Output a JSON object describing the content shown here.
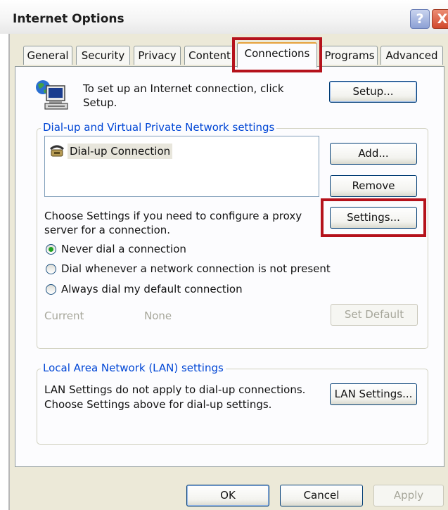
{
  "window": {
    "title": "Internet Options",
    "help_glyph": "?",
    "close_glyph": "X"
  },
  "tabs": [
    {
      "label": "General"
    },
    {
      "label": "Security"
    },
    {
      "label": "Privacy"
    },
    {
      "label": "Content"
    },
    {
      "label": "Connections"
    },
    {
      "label": "Programs"
    },
    {
      "label": "Advanced"
    }
  ],
  "active_tab": "Connections",
  "setup": {
    "text_line1": "To set up an Internet connection, click",
    "text_line2": "Setup.",
    "button_label": "Setup..."
  },
  "dialup_group": {
    "legend": "Dial-up and Virtual Private Network settings",
    "connections": [
      {
        "name": "Dial-up Connection"
      }
    ],
    "add_label": "Add...",
    "remove_label": "Remove",
    "settings_text_line1": "Choose Settings if you need to configure a proxy",
    "settings_text_line2": "server for a connection.",
    "settings_label": "Settings...",
    "radio_options": [
      {
        "label": "Never dial a connection",
        "selected": true
      },
      {
        "label": "Dial whenever a network connection is not present",
        "selected": false
      },
      {
        "label": "Always dial my default connection",
        "selected": false
      }
    ],
    "current_label": "Current",
    "current_value": "None",
    "set_default_label": "Set Default"
  },
  "lan_group": {
    "legend": "Local Area Network (LAN) settings",
    "text_line1": "LAN Settings do not apply to dial-up connections.",
    "text_line2": "Choose Settings above for dial-up settings.",
    "button_label": "LAN Settings..."
  },
  "footer": {
    "ok_label": "OK",
    "cancel_label": "Cancel",
    "apply_label": "Apply"
  },
  "colors": {
    "highlight_box": "#b5121b",
    "group_legend": "#0046d5",
    "dialog_face": "#ece9d8"
  }
}
